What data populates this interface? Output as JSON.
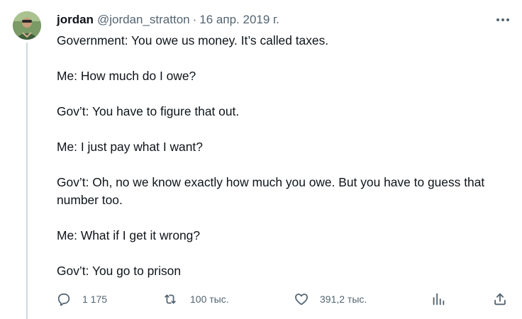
{
  "tweet": {
    "author_name": "jordan",
    "author_handle": "@jordan_stratton",
    "separator": "·",
    "date": "16 апр. 2019 г.",
    "lines": [
      "Government: You owe us money. It’s called taxes.",
      "Me: How much do I owe?",
      "Gov’t: You have to figure that out.",
      "Me: I just pay what I want?",
      "Gov’t: Oh, no we know exactly how much you owe. But you have to guess that number too.",
      "Me: What if I get it wrong?",
      "Gov’t: You go to prison"
    ]
  },
  "actions": {
    "reply_count": "1 175",
    "retweet_count": "100 тыс.",
    "like_count": "391,2 тыс."
  },
  "icons": {
    "more": "more-horizontal-icon",
    "reply": "reply-bubble-icon",
    "retweet": "retweet-icon",
    "like": "heart-icon",
    "views": "analytics-bars-icon",
    "share": "share-upload-icon"
  },
  "colors": {
    "text": "#0f1419",
    "secondary": "#536471",
    "thread_line": "#cfd9de"
  }
}
